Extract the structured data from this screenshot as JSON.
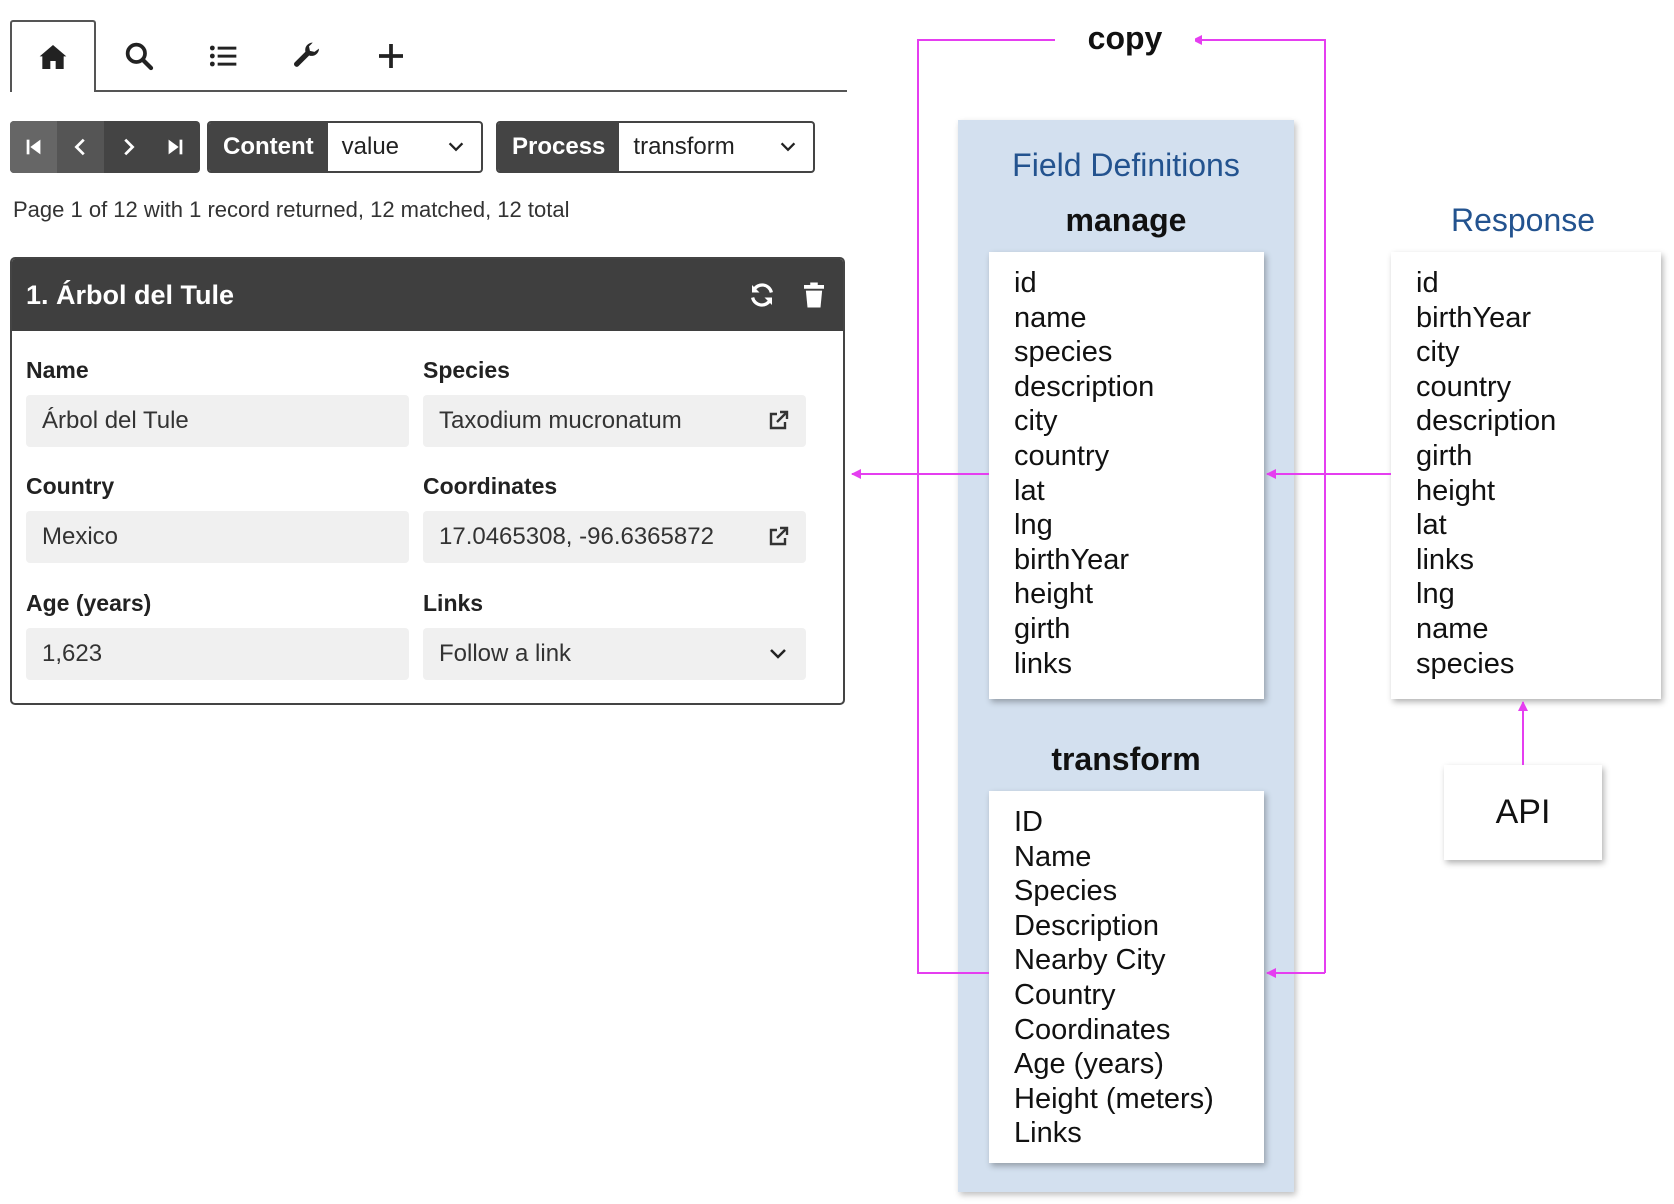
{
  "tabs": [
    {
      "name": "home",
      "icon": "home-icon",
      "active": true
    },
    {
      "name": "search",
      "icon": "search-icon",
      "active": false
    },
    {
      "name": "list",
      "icon": "list-icon",
      "active": false
    },
    {
      "name": "tools",
      "icon": "wrench-icon",
      "active": false
    },
    {
      "name": "add",
      "icon": "plus-icon",
      "active": false
    }
  ],
  "pager": {
    "icons": [
      "first-page-icon",
      "previous-page-icon",
      "next-page-icon",
      "last-page-icon"
    ]
  },
  "content_select": {
    "label": "Content",
    "value": "value"
  },
  "process_select": {
    "label": "Process",
    "value": "transform"
  },
  "status": "Page 1 of 12 with 1 record returned, 12 matched, 12 total",
  "record": {
    "title": "1. Árbol del Tule",
    "fields": {
      "name": {
        "label": "Name",
        "value": "Árbol del Tule"
      },
      "species": {
        "label": "Species",
        "value": "Taxodium mucronatum"
      },
      "country": {
        "label": "Country",
        "value": "Mexico"
      },
      "coordinates": {
        "label": "Coordinates",
        "value": "17.0465308, -96.6365872"
      },
      "age": {
        "label": "Age (years)",
        "value": "1,623"
      },
      "links": {
        "label": "Links",
        "value": "Follow a link"
      }
    }
  },
  "diagram": {
    "copy_label": "copy",
    "field_definitions_title": "Field Definitions",
    "manage": {
      "title": "manage",
      "fields": [
        "id",
        "name",
        "species",
        "description",
        "city",
        "country",
        "lat",
        "lng",
        "birthYear",
        "height",
        "girth",
        "links"
      ]
    },
    "transform": {
      "title": "transform",
      "fields": [
        "ID",
        "Name",
        "Species",
        "Description",
        "Nearby City",
        "Country",
        "Coordinates",
        "Age (years)",
        "Height (meters)",
        "Links"
      ]
    },
    "response": {
      "title": "Response",
      "fields": [
        "id",
        "birthYear",
        "city",
        "country",
        "description",
        "girth",
        "height",
        "lat",
        "links",
        "lng",
        "name",
        "species"
      ]
    },
    "api_label": "API",
    "arrow_color": "#e53ef0",
    "panel_color": "#d3e0ef",
    "title_color": "#23538f"
  }
}
